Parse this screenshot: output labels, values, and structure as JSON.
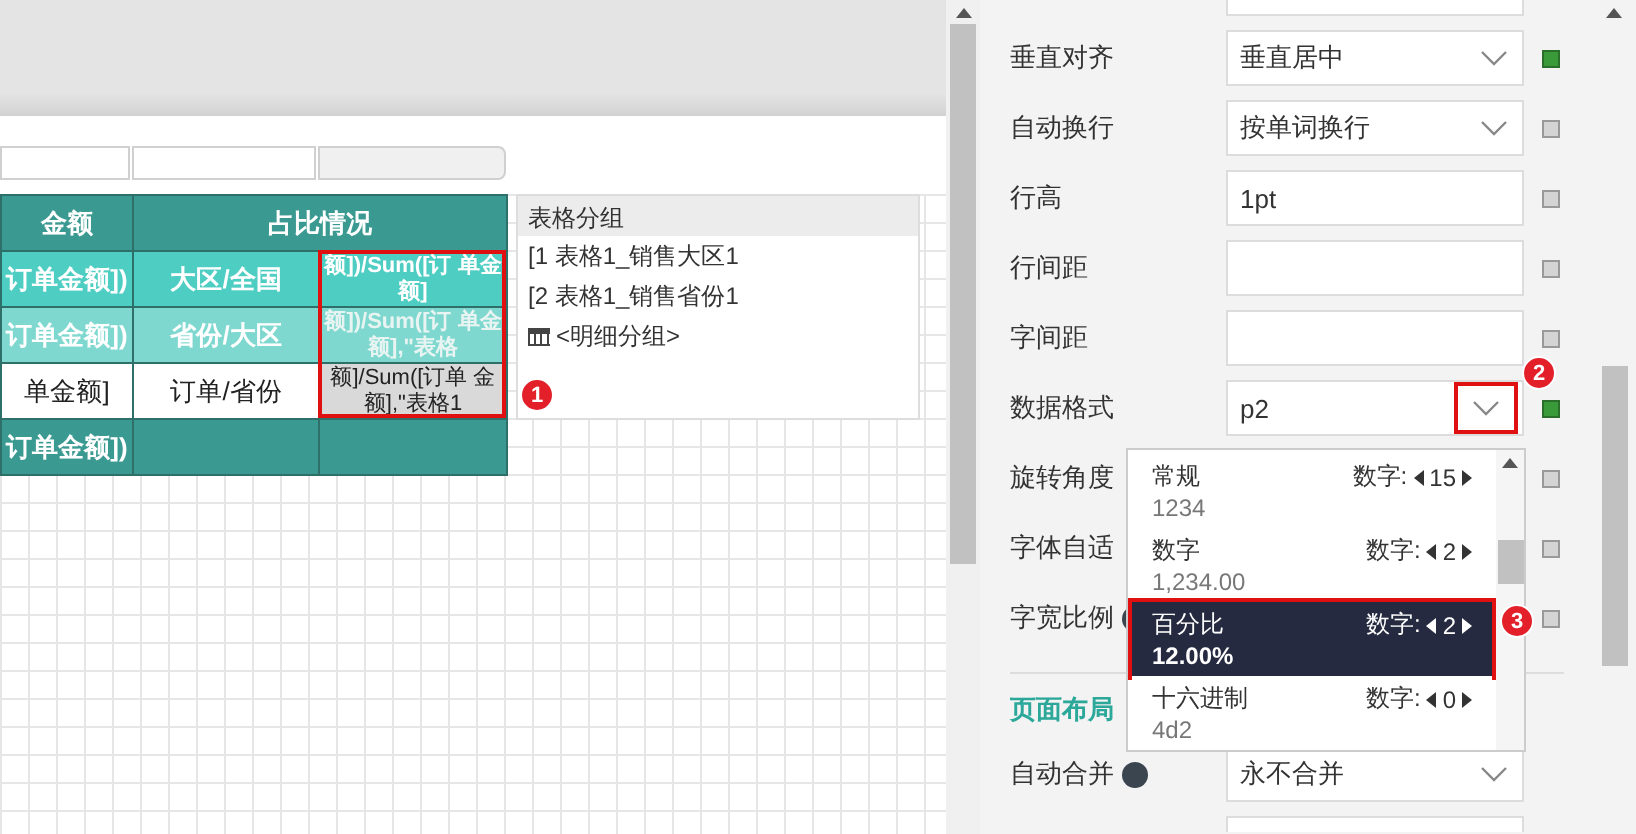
{
  "sheet_tabs": [
    {
      "selected": false
    },
    {
      "selected": false
    },
    {
      "selected": true
    }
  ],
  "table": {
    "header": [
      "金额",
      "占比情况"
    ],
    "rows": [
      {
        "kind": "level1",
        "cells": [
          "订单金额])",
          "大区/全国",
          "额])/Sum([订 单金额]"
        ]
      },
      {
        "kind": "level2",
        "cells": [
          "订单金额])",
          "省份/大区",
          "额])/Sum([订 单金额],\"表格"
        ]
      },
      {
        "kind": "detail",
        "cells": [
          "单金额]",
          "订单/省份",
          "额]/Sum([订单 金额],\"表格1"
        ]
      },
      {
        "kind": "total",
        "cells": [
          "订单金额])",
          null,
          null
        ]
      }
    ],
    "callout": "1"
  },
  "group_panel": {
    "title": "表格分组",
    "items": [
      {
        "kind": "group",
        "label": "[1 表格1_销售大区1"
      },
      {
        "kind": "group",
        "label": "[2 表格1_销售省份1"
      },
      {
        "kind": "detail",
        "label": "<明细分组>"
      }
    ]
  },
  "properties": [
    {
      "label": "垂直对齐",
      "kind": "select",
      "value": "垂直居中",
      "set": true
    },
    {
      "label": "自动换行",
      "kind": "select",
      "value": "按单词换行",
      "set": false
    },
    {
      "label": "行高",
      "kind": "input",
      "value": "1pt",
      "set": false
    },
    {
      "label": "行间距",
      "kind": "input",
      "set": false
    },
    {
      "label": "字间距",
      "kind": "input",
      "set": false
    },
    {
      "label": "数据格式",
      "kind": "select",
      "value": "p2",
      "set": true,
      "callout": "2"
    },
    {
      "label": "旋转角度",
      "kind": "blank",
      "set": false
    },
    {
      "label": "字体自适",
      "kind": "blank",
      "set": false
    },
    {
      "label": "字宽比例",
      "kind": "blank",
      "set": false,
      "help": true
    }
  ],
  "format_dropdown": {
    "callout": "3",
    "items": [
      {
        "name": "常规",
        "sample": "1234",
        "digits_label": "数字:",
        "digits": "15",
        "selected": false
      },
      {
        "name": "数字",
        "sample": "1,234.00",
        "digits_label": "数字:",
        "digits": "2",
        "selected": false
      },
      {
        "name": "百分比",
        "sample": "12.00%",
        "digits_label": "数字:",
        "digits": "2",
        "selected": true
      },
      {
        "name": "十六进制",
        "sample": "4d2",
        "digits_label": "数字:",
        "digits": "0",
        "selected": false
      }
    ]
  },
  "page_layout": {
    "title": "页面布局",
    "properties": [
      {
        "label": "自动合并",
        "kind": "select",
        "value": "永不合并",
        "help": true
      }
    ]
  }
}
